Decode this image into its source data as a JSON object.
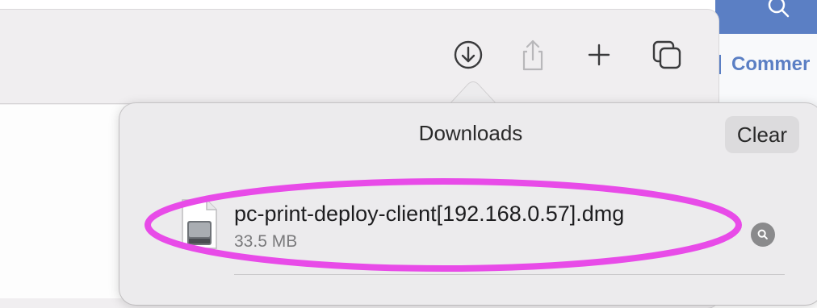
{
  "toolbar": {
    "buttons": [
      {
        "icon": "download-icon"
      },
      {
        "icon": "share-icon"
      },
      {
        "icon": "plus-icon"
      },
      {
        "icon": "tabs-overview-icon"
      }
    ]
  },
  "background_page": {
    "section_label": "Commer",
    "accent_color": "#5b7fc4"
  },
  "downloads": {
    "title": "Downloads",
    "clear_label": "Clear",
    "items": [
      {
        "file_name": "pc-print-deploy-client[192.168.0.57].dmg",
        "file_size": "33.5 MB",
        "icon": "disk-image-icon"
      }
    ]
  },
  "annotation": {
    "color": "#e84be8"
  }
}
